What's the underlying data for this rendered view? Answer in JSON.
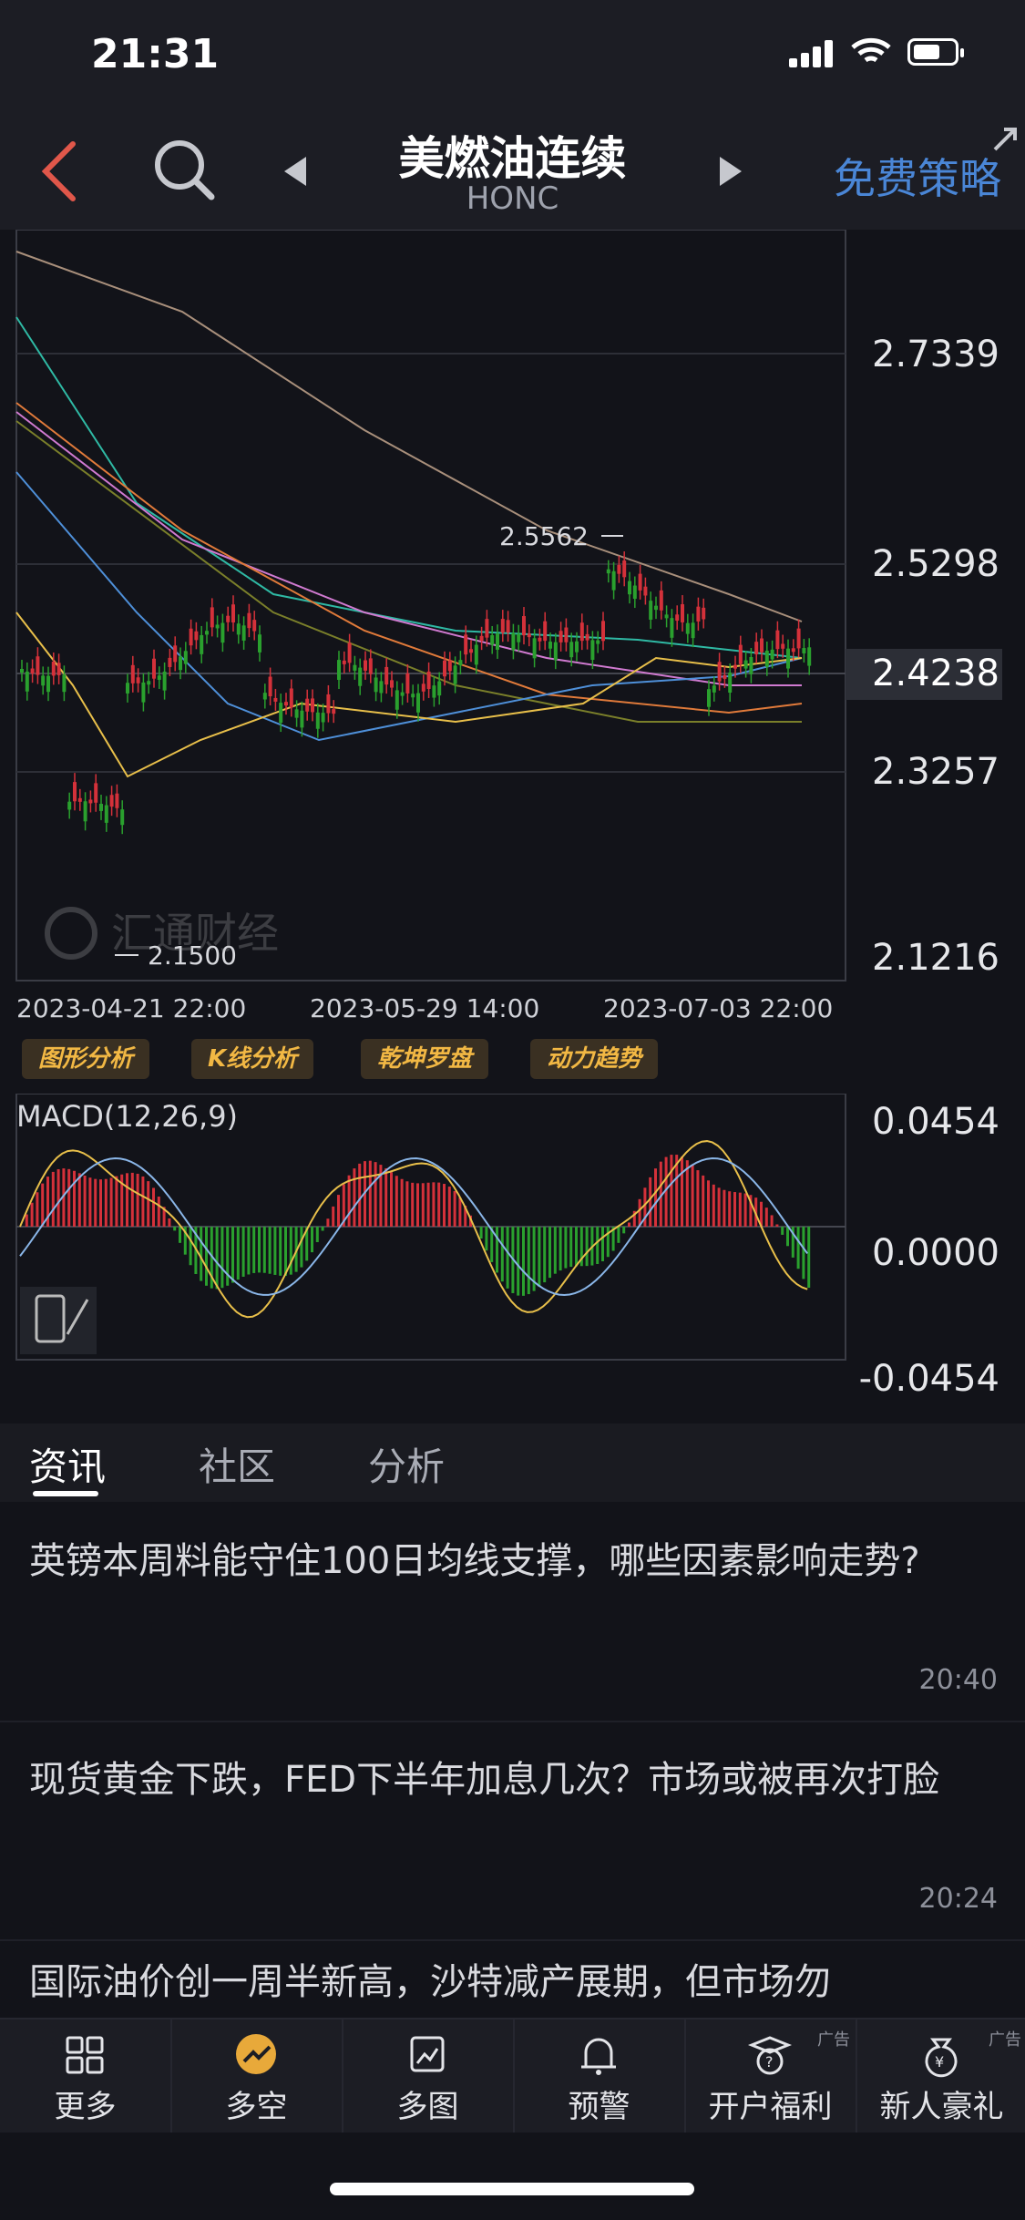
{
  "status_bar": {
    "time": "21:31"
  },
  "header": {
    "title": "美燃油连续",
    "symbol": "HONC",
    "strategy_label": "免费策略"
  },
  "colors": {
    "up": "#d4313a",
    "down": "#2aa02e",
    "accent": "#4a86d6",
    "tool_text": "#f2b844"
  },
  "chart": {
    "price_labels": [
      "2.7339",
      "2.5298",
      "2.4238",
      "2.3257",
      "2.1216"
    ],
    "current_price": "2.4238",
    "high_marker": "2.5562",
    "low_marker": "2.1500",
    "watermark": "汇通财经",
    "dates": [
      "2023-04-21 22:00",
      "2023-05-29 14:00",
      "2023-07-03 22:00"
    ],
    "tools": [
      "图形分析",
      "K线分析",
      "乾坤罗盘",
      "动力趋势"
    ],
    "macd_title": "MACD(12,26,9)",
    "macd_labels": [
      "0.0454",
      "0.0000",
      "-0.0454"
    ]
  },
  "tabs": [
    "资讯",
    "社区",
    "分析"
  ],
  "news": [
    {
      "title": "英镑本周料能守住100日均线支撑，哪些因素影响走势?",
      "time": "20:40"
    },
    {
      "title": "现货黄金下跌，FED下半年加息几次？市场或被再次打脸",
      "time": "20:24"
    },
    {
      "title": "国际油价创一周半新高，沙特减产展期，但市场勿",
      "time": ""
    }
  ],
  "bottom_nav": [
    {
      "label": "更多",
      "icon": "grid-icon"
    },
    {
      "label": "多空",
      "icon": "trend-icon"
    },
    {
      "label": "多图",
      "icon": "multi-chart-icon"
    },
    {
      "label": "预警",
      "icon": "bell-icon"
    },
    {
      "label": "开户福利",
      "icon": "gift-hat-icon",
      "ad": "广告"
    },
    {
      "label": "新人豪礼",
      "icon": "money-bag-icon",
      "ad": "广告"
    }
  ]
}
